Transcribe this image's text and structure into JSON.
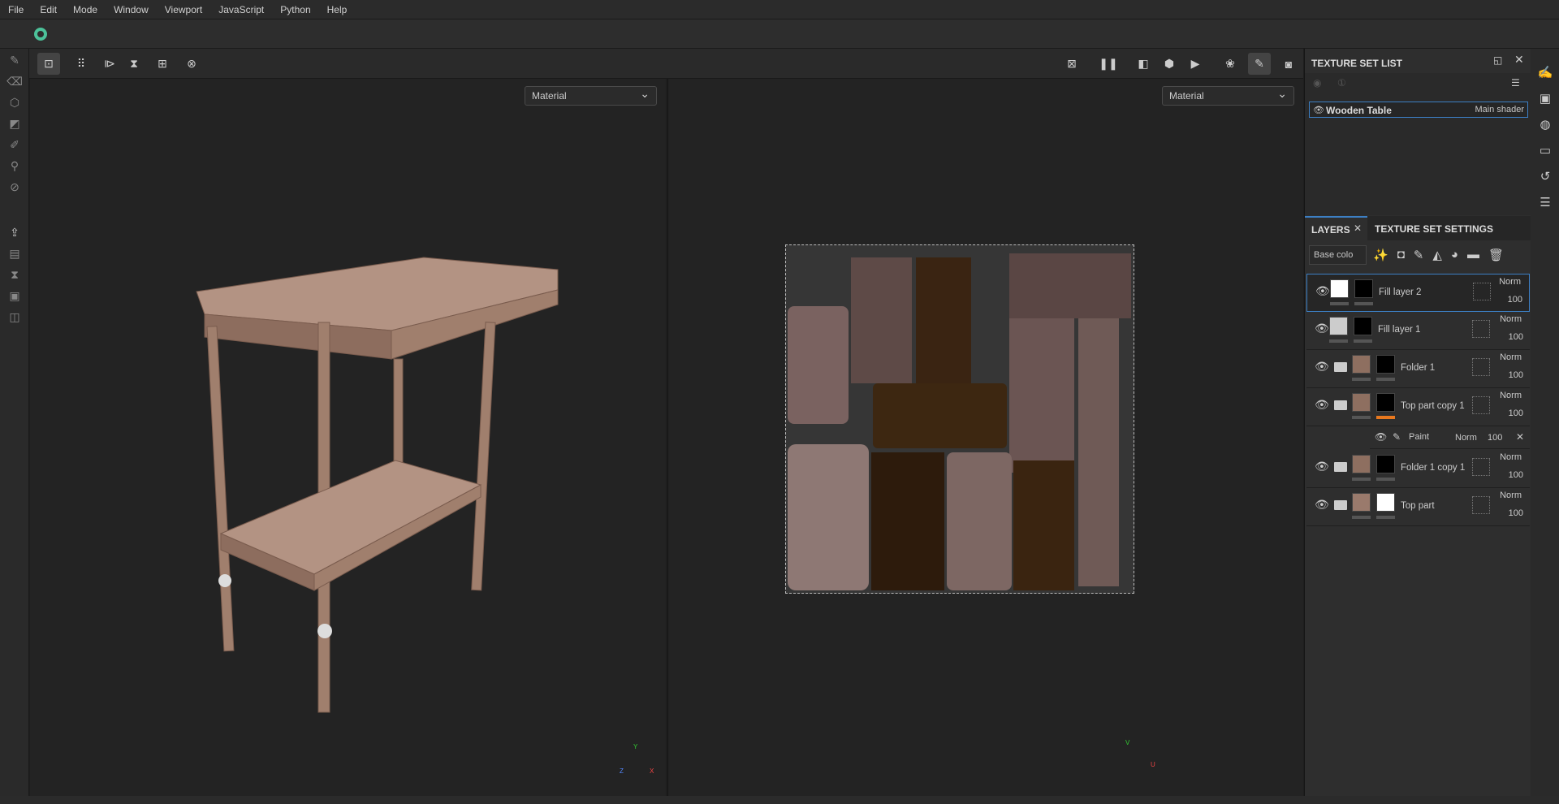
{
  "menu": [
    "File",
    "Edit",
    "Mode",
    "Window",
    "Viewport",
    "JavaScript",
    "Python",
    "Help"
  ],
  "viewport_left": {
    "shader_select": "Material",
    "axes": [
      "Y",
      "X",
      "Z"
    ]
  },
  "viewport_right": {
    "shader_select": "Material",
    "axes": [
      "V",
      "U"
    ]
  },
  "texture_set_list": {
    "title": "TEXTURE SET LIST",
    "item": {
      "name": "Wooden Table",
      "shader": "Main shader"
    }
  },
  "layers_panel": {
    "tab_layers": "LAYERS",
    "tab_settings": "TEXTURE SET SETTINGS",
    "channel_select": "Base colo",
    "layers": [
      {
        "name": "Fill layer 2",
        "blend": "Norm",
        "opacity": "100",
        "folder": false,
        "selected": true
      },
      {
        "name": "Fill layer 1",
        "blend": "Norm",
        "opacity": "100",
        "folder": false
      },
      {
        "name": "Folder 1",
        "blend": "Norm",
        "opacity": "100",
        "folder": true
      },
      {
        "name": "Top part copy 1",
        "blend": "Norm",
        "opacity": "100",
        "folder": true
      },
      {
        "name": "Folder 1 copy 1",
        "blend": "Norm",
        "opacity": "100",
        "folder": true
      },
      {
        "name": "Top part",
        "blend": "Norm",
        "opacity": "100",
        "folder": true
      }
    ],
    "effect": {
      "name": "Paint",
      "blend": "Norm",
      "opacity": "100"
    }
  },
  "colors": {
    "accent": "#3c7fc4",
    "mask_highlight": "#e8781e",
    "logo": "#4cc29a"
  }
}
